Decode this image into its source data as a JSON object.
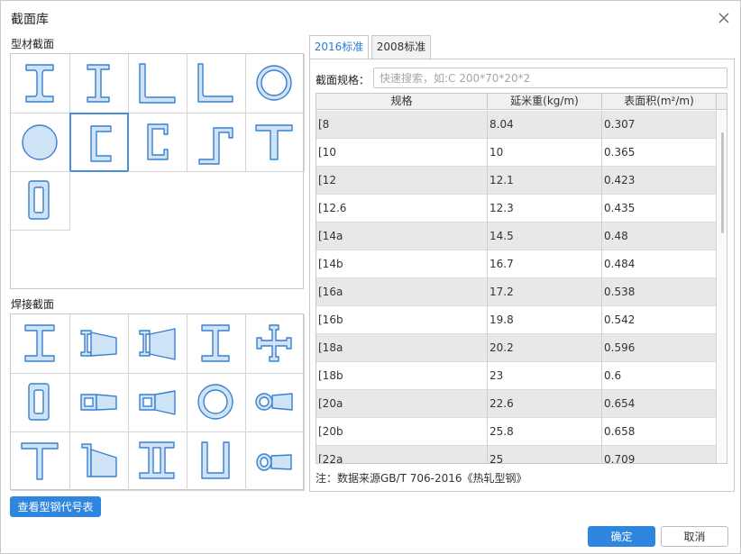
{
  "dialog": {
    "title": "截面库",
    "section_profile_label": "型材截面",
    "section_welded_label": "焊接截面"
  },
  "profile_shapes": [
    "i-beam-icon",
    "i-beam-narrow-icon",
    "equal-angle-icon",
    "unequal-angle-icon",
    "round-tube-icon",
    "round-bar-icon",
    "channel-icon",
    "lipped-channel-icon",
    "z-section-icon",
    "t-section-icon",
    "rect-tube-icon"
  ],
  "welded_shapes": [
    "welded-i-icon",
    "tapered-i-right-icon",
    "tapered-i-left-icon",
    "welded-i-narrow-icon",
    "cross-section-icon",
    "welded-box-icon",
    "tapered-box-right-icon",
    "tapered-box-left-icon",
    "welded-round-tube-icon",
    "tapered-round-icon",
    "welded-t-icon",
    "tapered-t-icon",
    "double-i-icon",
    "welded-u-icon",
    "tapered-round-small-icon"
  ],
  "selected_profile_index": 6,
  "tabs": [
    {
      "label": "2016标准",
      "active": true
    },
    {
      "label": "2008标准",
      "active": false
    }
  ],
  "search": {
    "label": "截面规格：",
    "placeholder": "快速搜索，如:C 200*70*20*2"
  },
  "table": {
    "headers": [
      "规格",
      "延米重(kg/m)",
      "表面积(m²/m)"
    ],
    "rows": [
      [
        "[8",
        "8.04",
        "0.307"
      ],
      [
        "[10",
        "10",
        "0.365"
      ],
      [
        "[12",
        "12.1",
        "0.423"
      ],
      [
        "[12.6",
        "12.3",
        "0.435"
      ],
      [
        "[14a",
        "14.5",
        "0.48"
      ],
      [
        "[14b",
        "16.7",
        "0.484"
      ],
      [
        "[16a",
        "17.2",
        "0.538"
      ],
      [
        "[16b",
        "19.8",
        "0.542"
      ],
      [
        "[18a",
        "20.2",
        "0.596"
      ],
      [
        "[18b",
        "23",
        "0.6"
      ],
      [
        "[20a",
        "22.6",
        "0.654"
      ],
      [
        "[20b",
        "25.8",
        "0.658"
      ],
      [
        "[22a",
        "25",
        "0.709"
      ]
    ]
  },
  "note": "注：数据来源GB/T 706-2016《热轧型钢》",
  "buttons": {
    "code_table": "查看型钢代号表",
    "ok": "确定",
    "cancel": "取消"
  },
  "colors": {
    "accent": "#2e86de",
    "shape_fill": "#cfe3f7",
    "shape_stroke": "#3a7fd0"
  }
}
